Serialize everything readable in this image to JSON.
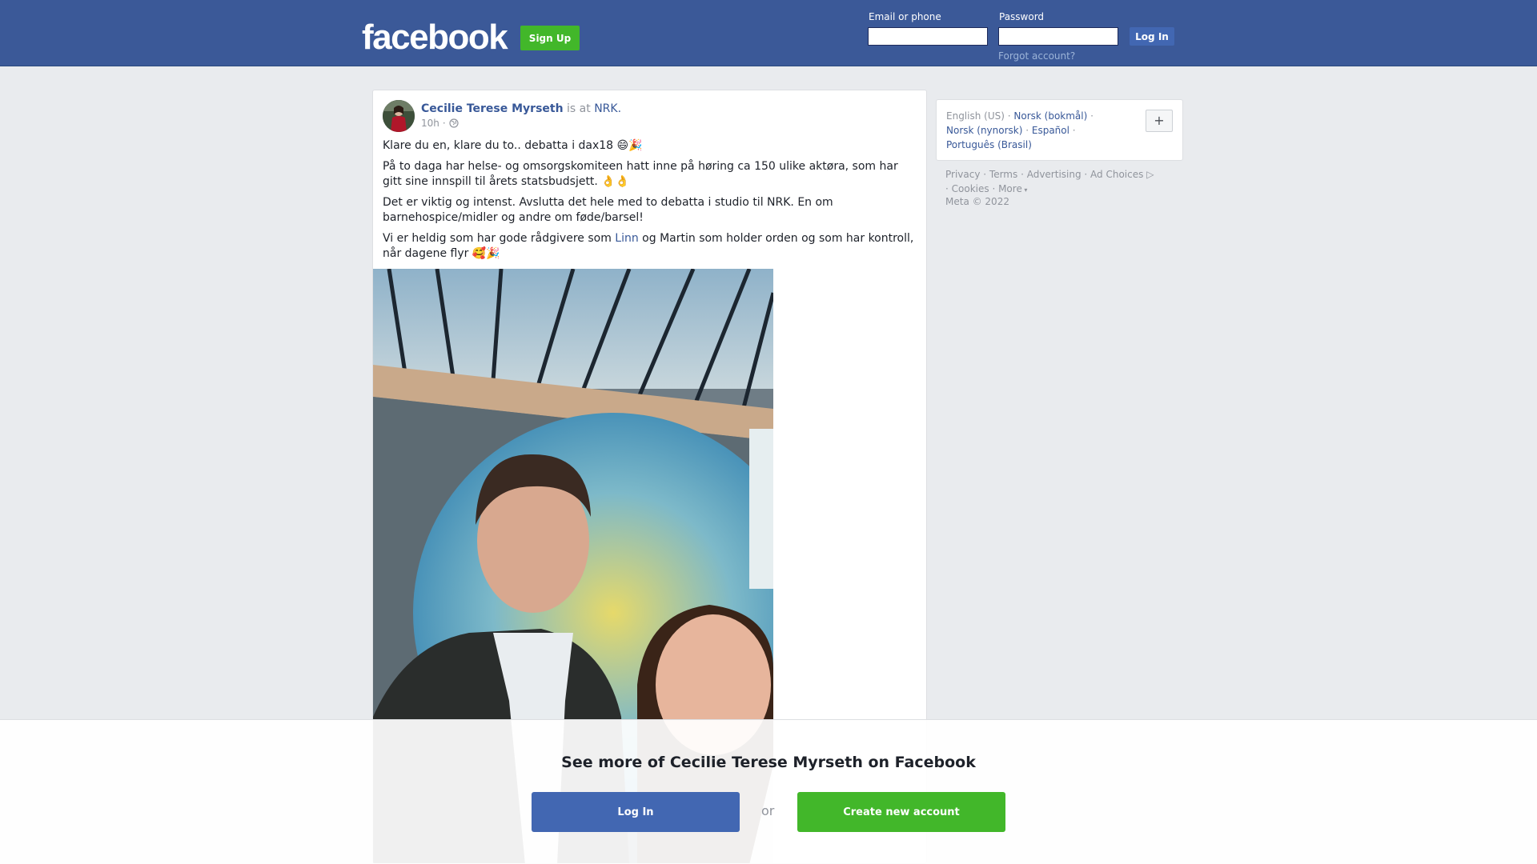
{
  "header": {
    "logo": "facebook",
    "signup_label": "Sign Up",
    "email_label": "Email or phone",
    "password_label": "Password",
    "login_label": "Log In",
    "forgot_label": "Forgot account?"
  },
  "post": {
    "author": "Cecilie Terese Myrseth",
    "is_at": "is at",
    "place": "NRK.",
    "time": "10h",
    "privacy_icon": "globe-icon",
    "paragraphs": [
      "Klare du en, klare du to.. debatta i dax18 😄🎉",
      "På to daga har helse- og omsorgskomiteen hatt inne på høring ca 150 ulike aktøra, som har gitt sine innspill til årets statsbudsjett. 👌👌",
      "Det er viktig og intenst. Avslutta det hele med to debatta i studio til NRK. En om barnehospice/midler og andre om føde/barsel!"
    ],
    "last_before": "Vi er heldig som har gode rådgivere som ",
    "last_link": "Linn",
    "last_after": " og Martin som holder orden og som har kontroll, når dagene flyr 🥰🎉"
  },
  "sidebar": {
    "lang_current": "English (US)",
    "lang_1": "Norsk (bokmål)",
    "lang_2": "Norsk (nynorsk)",
    "lang_3": "Español",
    "lang_4": "Português (Brasil)",
    "lang_more": "+",
    "sep": " · ",
    "footer_privacy": "Privacy",
    "footer_terms": "Terms",
    "footer_advertising": "Advertising",
    "footer_adchoices": "Ad Choices",
    "footer_cookies": "Cookies",
    "footer_more": "More",
    "copyright": "Meta © 2022"
  },
  "overlay": {
    "title": "See more of Cecilie Terese Myrseth on Facebook",
    "login_label": "Log In",
    "or_label": "or",
    "create_label": "Create new account"
  },
  "colors": {
    "brand_blue": "#3b5998",
    "button_blue": "#4267b2",
    "link_blue": "#385898",
    "green": "#42b72a",
    "background": "#e9ebee"
  }
}
